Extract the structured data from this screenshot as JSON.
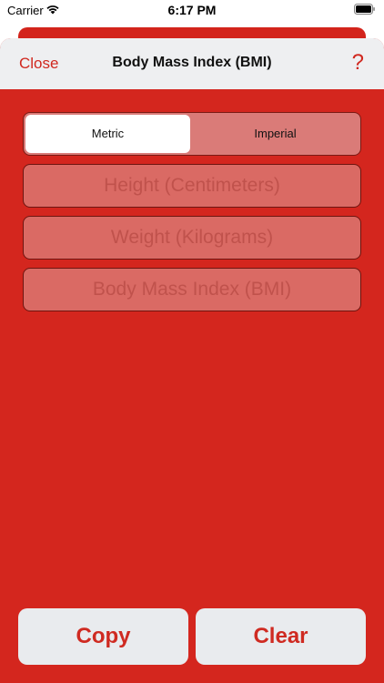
{
  "status_bar": {
    "carrier": "Carrier",
    "time": "6:17 PM",
    "wifi_icon": "wifi-icon",
    "battery_icon": "battery-icon"
  },
  "nav": {
    "close_label": "Close",
    "title": "Body Mass Index (BMI)",
    "help_label": "?"
  },
  "units": {
    "options": [
      "Metric",
      "Imperial"
    ],
    "selected": "Metric"
  },
  "fields": {
    "height_placeholder": "Height (Centimeters)",
    "weight_placeholder": "Weight (Kilograms)",
    "bmi_placeholder": "Body Mass Index (BMI)"
  },
  "actions": {
    "copy_label": "Copy",
    "clear_label": "Clear"
  },
  "colors": {
    "accent": "#d4261e",
    "nav_background": "#eeeff1",
    "button_background": "#e9ebee"
  }
}
